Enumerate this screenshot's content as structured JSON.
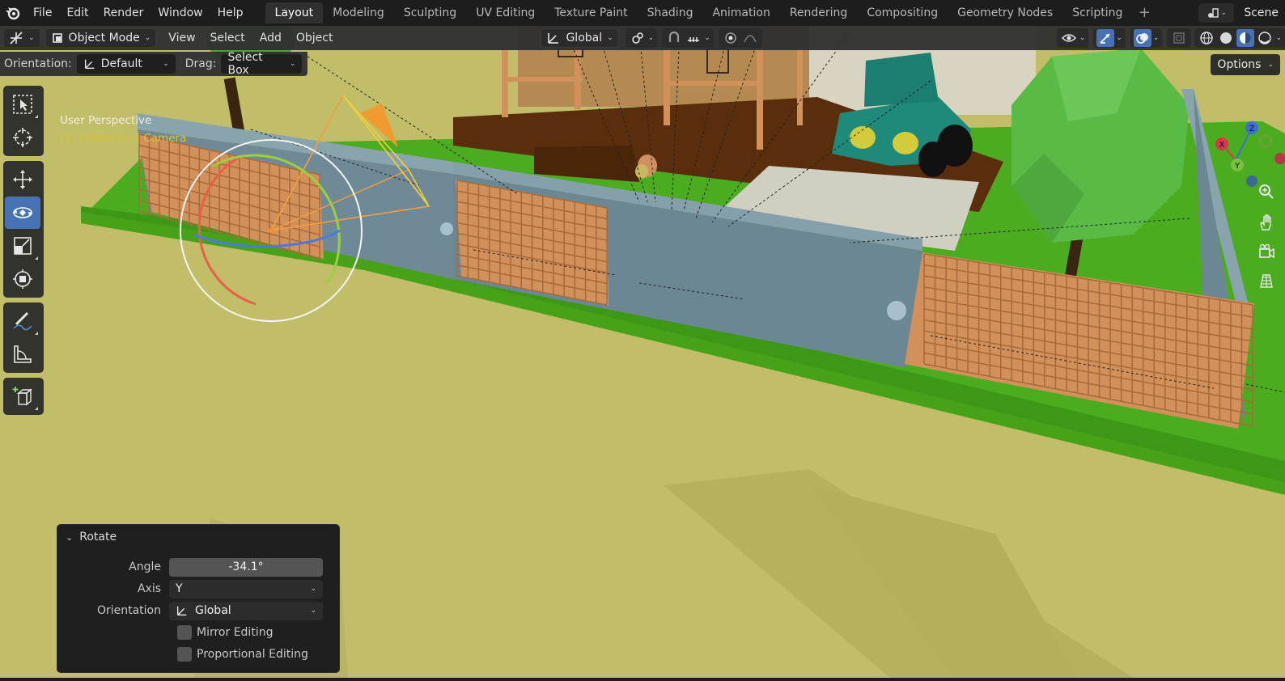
{
  "menu": [
    "File",
    "Edit",
    "Render",
    "Window",
    "Help"
  ],
  "workspaces": [
    {
      "label": "Layout",
      "active": true
    },
    {
      "label": "Modeling",
      "active": false
    },
    {
      "label": "Sculpting",
      "active": false
    },
    {
      "label": "UV Editing",
      "active": false
    },
    {
      "label": "Texture Paint",
      "active": false
    },
    {
      "label": "Shading",
      "active": false
    },
    {
      "label": "Animation",
      "active": false
    },
    {
      "label": "Rendering",
      "active": false
    },
    {
      "label": "Compositing",
      "active": false
    },
    {
      "label": "Geometry Nodes",
      "active": false
    },
    {
      "label": "Scripting",
      "active": false
    }
  ],
  "add_workspace": "+",
  "scene": {
    "name": "Scene"
  },
  "header": {
    "mode": "Object Mode",
    "menus": [
      "View",
      "Select",
      "Add",
      "Object"
    ],
    "transform_orientation": "Global"
  },
  "tool_settings": {
    "orientation_label": "Orientation:",
    "orientation_value": "Default",
    "drag_label": "Drag:",
    "drag_value": "Select Box",
    "options_label": "Options"
  },
  "viewport": {
    "view_name": "User Perspective",
    "collection_prefix": "(1) Collection",
    "separator": "|",
    "active_object": "Camera"
  },
  "gizmo": {
    "x": "X",
    "y": "Y",
    "z": "Z"
  },
  "operator_panel": {
    "title": "Rotate",
    "angle_label": "Angle",
    "angle_value": "-34.1°",
    "axis_label": "Axis",
    "axis_value": "Y",
    "orientation_label": "Orientation",
    "orientation_value": "Global",
    "mirror_label": "Mirror Editing",
    "mirror_checked": false,
    "proportional_label": "Proportional Editing",
    "proportional_checked": false
  },
  "colors": {
    "accent": "#4772b3",
    "ground": "#c2bd68",
    "grass": "#4cac20",
    "wall": "#6f8a96",
    "fence": "#d2905a",
    "deck": "#5a2e0c",
    "car": "#1f8a7a",
    "tree": "#5aba46",
    "collection_text": "#d6c23a"
  }
}
